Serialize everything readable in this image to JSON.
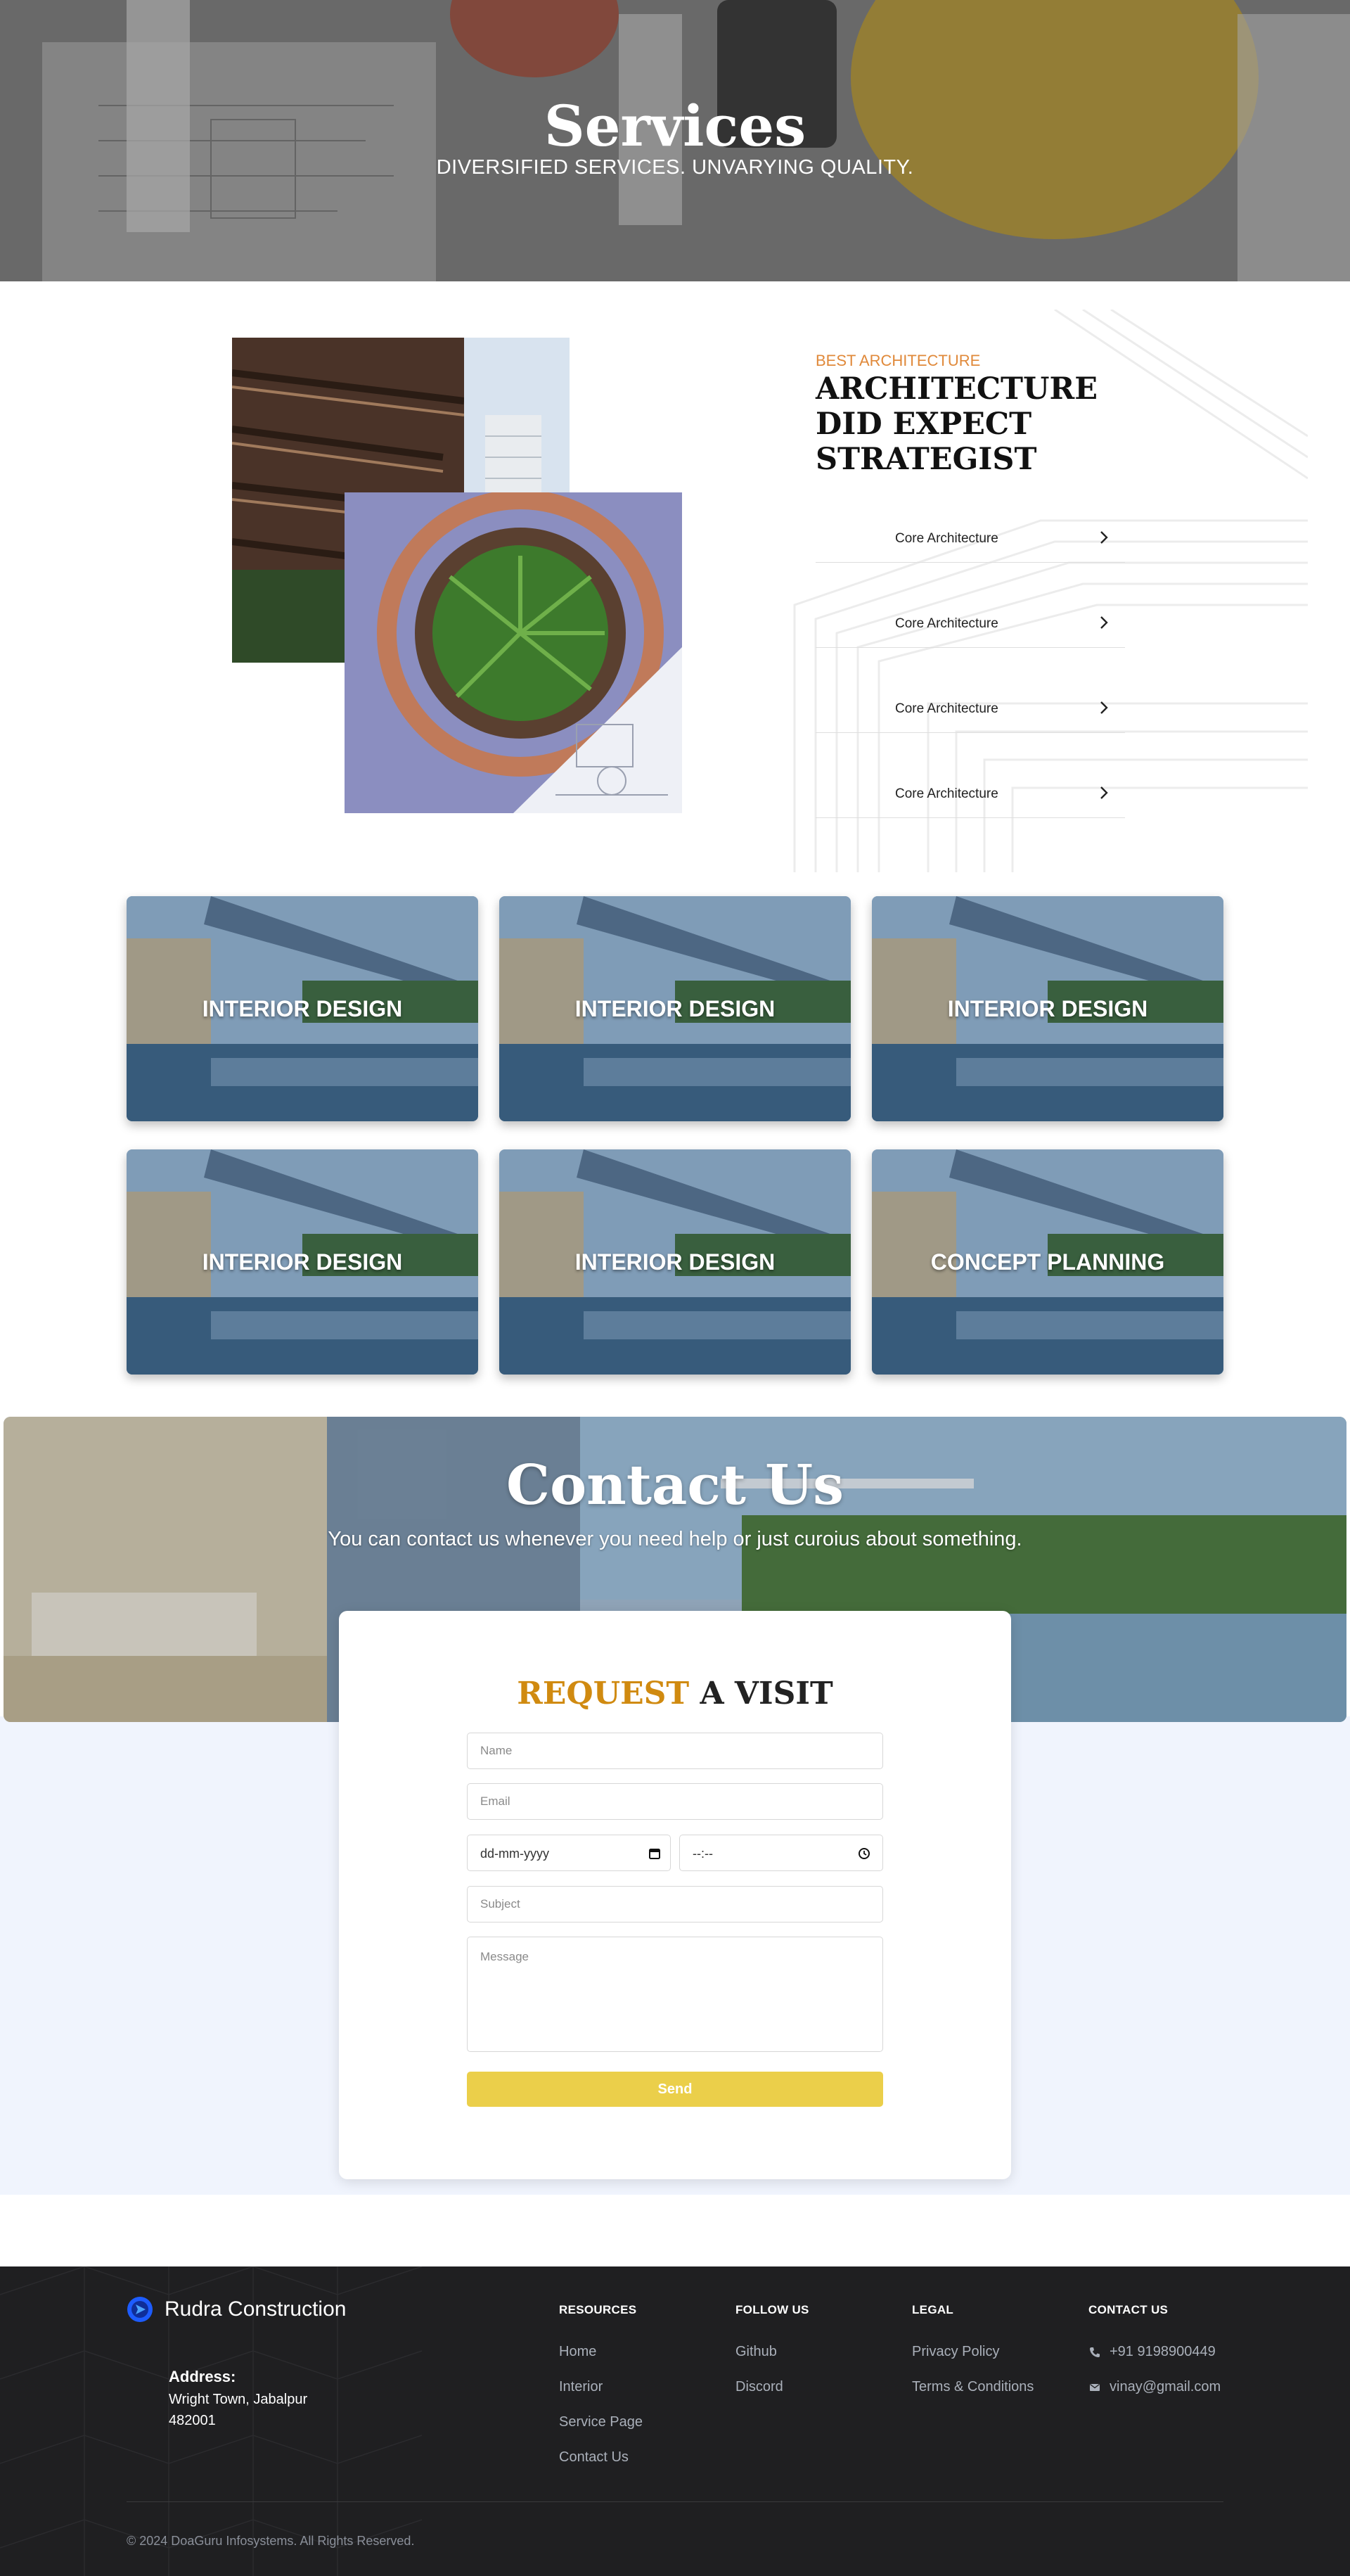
{
  "hero": {
    "title": "Services",
    "subtitle": "DIVERSIFIED SERVICES. UNVARYING QUALITY."
  },
  "architecture": {
    "eyebrow": "BEST ARCHITECTURE",
    "heading_lines": [
      "ARCHITECTURE",
      "DID EXPECT",
      "STRATEGIST"
    ],
    "items": [
      {
        "label": "Core Architecture"
      },
      {
        "label": "Core Architecture"
      },
      {
        "label": "Core Architecture"
      },
      {
        "label": "Core Architecture"
      }
    ]
  },
  "services": [
    {
      "title": "INTERIOR DESIGN"
    },
    {
      "title": "INTERIOR DESIGN"
    },
    {
      "title": "INTERIOR DESIGN"
    },
    {
      "title": "INTERIOR DESIGN"
    },
    {
      "title": "INTERIOR DESIGN"
    },
    {
      "title": "CONCEPT PLANNING"
    }
  ],
  "contact": {
    "title": "Contact Us",
    "subtitle": "You can contact us whenever you need help or just curoius about something.",
    "form": {
      "title_accent": "REQUEST",
      "title_rest": " A VISIT",
      "name_placeholder": "Name",
      "email_placeholder": "Email",
      "date_placeholder": "dd-mm-yyyy",
      "time_placeholder": "--:--",
      "subject_placeholder": "Subject",
      "message_placeholder": "Message",
      "send_label": "Send",
      "send_color": "#ebcf4a"
    }
  },
  "footer": {
    "brand": "Rudra Construction",
    "address_label": "Address:",
    "address_lines": [
      "Wright Town, Jabalpur",
      "482001"
    ],
    "columns": {
      "resources": {
        "title": "RESOURCES",
        "links": [
          "Home",
          "Interior",
          "Service Page",
          "Contact Us"
        ]
      },
      "follow": {
        "title": "FOLLOW US",
        "links": [
          "Github",
          "Discord"
        ]
      },
      "legal": {
        "title": "LEGAL",
        "links": [
          "Privacy Policy",
          "Terms & Conditions"
        ]
      },
      "contact": {
        "title": "CONTACT US",
        "phone": "+91 9198900449",
        "email": "vinay@gmail.com"
      }
    },
    "copyright": "© 2024 DoaGuru Infosystems. All Rights Reserved."
  },
  "icons": {
    "chevron": "chevron-right-icon",
    "phone": "phone-icon",
    "mail": "mail-icon",
    "calendar": "calendar-icon",
    "clock": "clock-icon"
  },
  "colors": {
    "accent_orange": "#e0893a",
    "accent_gold": "#d08a10",
    "footer_bg": "#1f1f21",
    "brand_blue": "#1d5cff",
    "form_page_bg": "#f0f4fd"
  }
}
